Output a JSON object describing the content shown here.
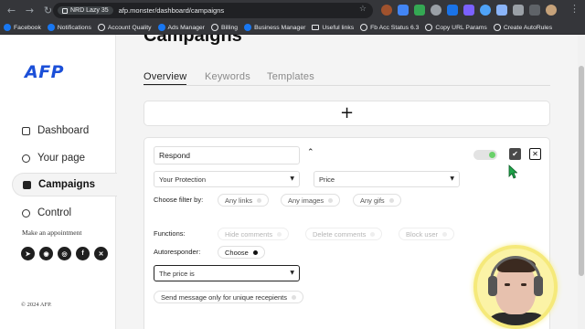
{
  "browser": {
    "profile_chip": "NRD Lazy 35",
    "url": "afp.monster/dashboard/campaigns",
    "bookmarks": [
      {
        "label": "Facebook",
        "icon": "facebook-icon"
      },
      {
        "label": "Notifications",
        "icon": "facebook-icon"
      },
      {
        "label": "Account Quality",
        "icon": "globe-icon"
      },
      {
        "label": "Ads Manager",
        "icon": "facebook-icon"
      },
      {
        "label": "Billing",
        "icon": "globe-icon"
      },
      {
        "label": "Business Manager",
        "icon": "facebook-icon"
      },
      {
        "label": "Useful links",
        "icon": "folder-icon"
      },
      {
        "label": "Fb Acc Status 6.3",
        "icon": "globe-icon"
      },
      {
        "label": "Copy URL Params",
        "icon": "globe-icon"
      },
      {
        "label": "Create AutoRules",
        "icon": "globe-icon"
      }
    ]
  },
  "sidebar": {
    "logo": "AFP",
    "items": [
      {
        "label": "Dashboard",
        "icon": "dashboard-icon"
      },
      {
        "label": "Your page",
        "icon": "person-icon"
      },
      {
        "label": "Campaigns",
        "icon": "campaigns-icon"
      },
      {
        "label": "Control",
        "icon": "toggle-icon"
      }
    ],
    "appointment": "Make an appointment",
    "socials": [
      {
        "name": "telegram-icon",
        "glyph": "➤"
      },
      {
        "name": "discord-icon",
        "glyph": "◉"
      },
      {
        "name": "instagram-icon",
        "glyph": "◎"
      },
      {
        "name": "facebook-icon",
        "glyph": "f"
      },
      {
        "name": "x-icon",
        "glyph": "✕"
      }
    ],
    "copyright": "© 2024 AFP."
  },
  "main": {
    "title": "Campaigns",
    "tabs": [
      "Overview",
      "Keywords",
      "Templates"
    ],
    "add_glyph": "+",
    "campaign": {
      "name": "Respond",
      "protection_select": "Your Protection",
      "price_select": "Price",
      "filter_label": "Choose filter by:",
      "filters": [
        "Any links",
        "Any images",
        "Any gifs"
      ],
      "functions_label": "Functions:",
      "functions": [
        "Hide comments",
        "Delete comments",
        "Block user"
      ],
      "autoresponder_label": "Autoresponder:",
      "autoresponder_choose": "Choose",
      "condition_select": "The price is",
      "unique_toggle": "Send message only for unique recepients"
    }
  }
}
